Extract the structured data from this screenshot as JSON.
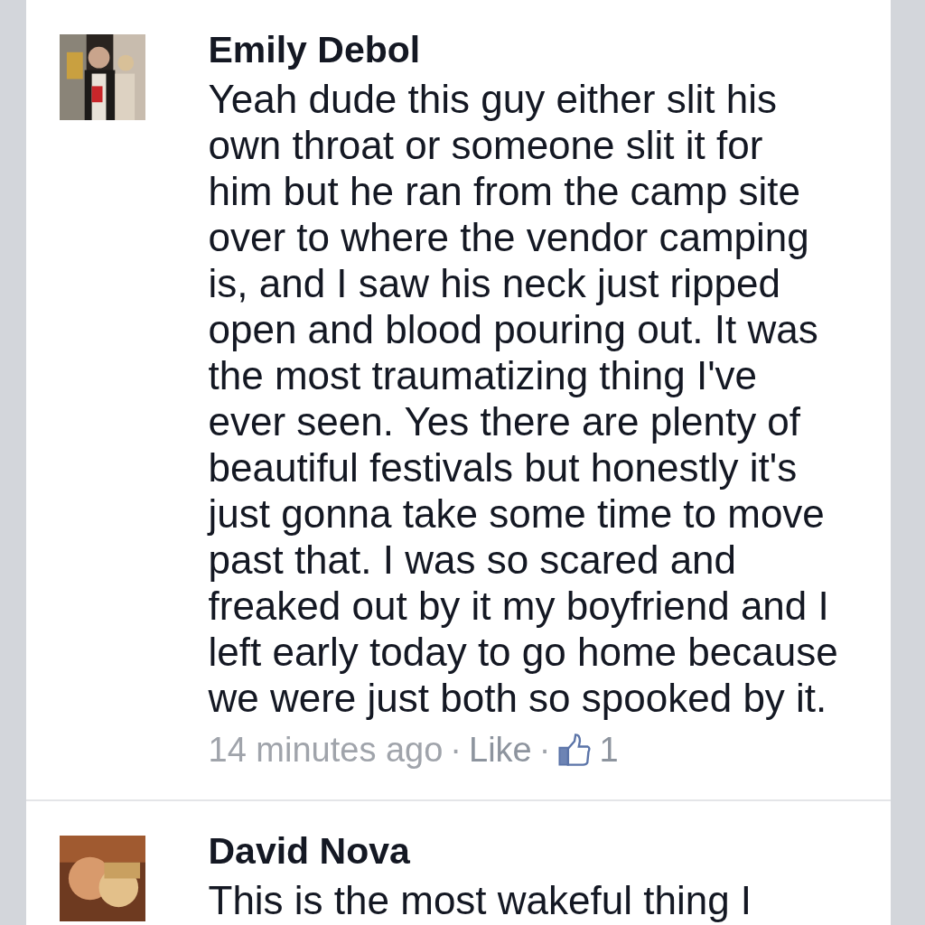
{
  "comments": [
    {
      "author": "Emily Debol",
      "lines": [
        "Yeah dude this guy either slit his",
        "own throat or someone slit it for",
        "him but he ran from the camp site",
        "over to where the vendor camping",
        "is, and I saw his neck just ripped",
        "open and blood pouring out. It was",
        "the most traumatizing thing I've",
        "ever seen. Yes there are plenty of",
        "beautiful festivals but honestly it's",
        "just gonna take some time to move",
        "past that. I was so scared and",
        "freaked out by it my boyfriend and I",
        "left early today to go home because",
        "we were just both so spooked by it."
      ],
      "time": "14 minutes ago",
      "separator": "·",
      "like_label": "Like",
      "like_count": "1"
    },
    {
      "author": "David Nova",
      "lines": [
        "This is the most wakeful thing I"
      ]
    }
  ]
}
